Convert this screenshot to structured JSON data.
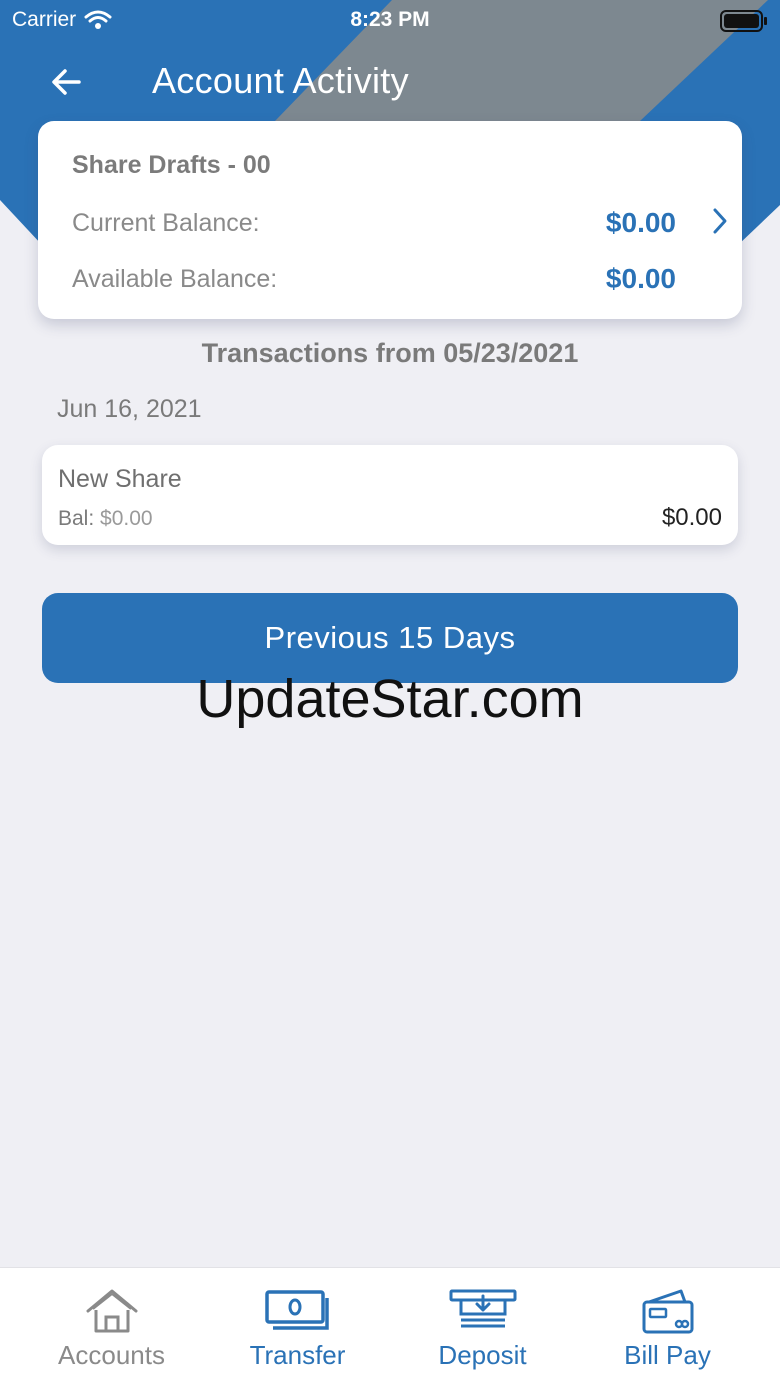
{
  "status_bar": {
    "carrier": "Carrier",
    "time": "8:23 PM"
  },
  "header": {
    "title": "Account Activity"
  },
  "colors": {
    "brand_blue": "#2a72b6",
    "header_gray": "#7d8890",
    "background": "#efeff4"
  },
  "account_card": {
    "name": "Share Drafts - 00",
    "current_balance_label": "Current Balance:",
    "current_balance_value": "$0.00",
    "available_balance_label": "Available Balance:",
    "available_balance_value": "$0.00"
  },
  "transactions": {
    "range_title": "Transactions from 05/23/2021",
    "groups": [
      {
        "date": "Jun 16, 2021",
        "items": [
          {
            "description": "New Share",
            "balance_label": "Bal:",
            "balance_value": "$0.00",
            "amount": "$0.00"
          }
        ]
      }
    ]
  },
  "previous_button": {
    "label": "Previous 15 Days"
  },
  "watermark": "UpdateStar.com",
  "tab_bar": {
    "items": [
      {
        "label": "Accounts",
        "icon": "home-icon",
        "active": false
      },
      {
        "label": "Transfer",
        "icon": "money-transfer-icon",
        "active": true
      },
      {
        "label": "Deposit",
        "icon": "deposit-icon",
        "active": true
      },
      {
        "label": "Bill Pay",
        "icon": "bill-pay-icon",
        "active": true
      }
    ]
  }
}
